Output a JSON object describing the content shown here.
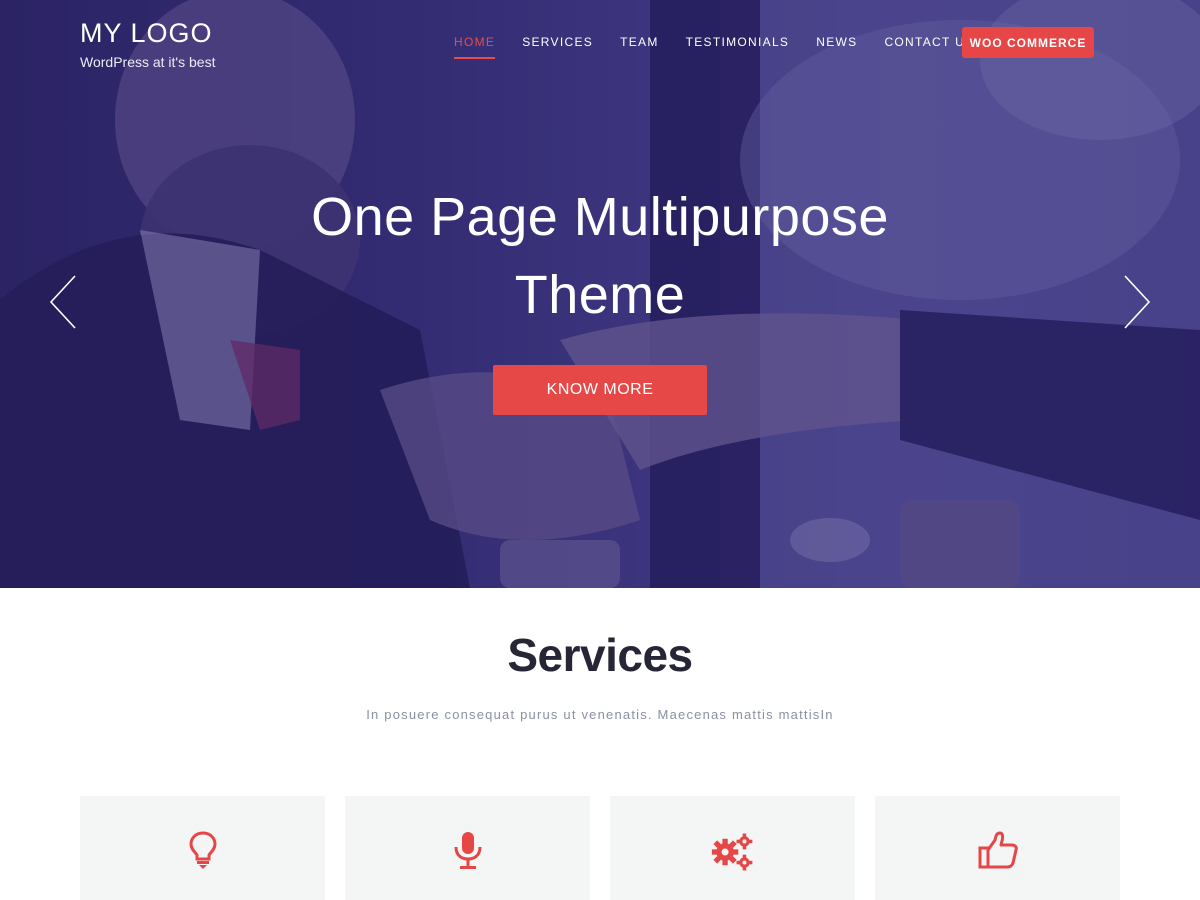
{
  "brand": {
    "title": "MY LOGO",
    "tagline": "WordPress at it's best"
  },
  "nav": {
    "items": [
      {
        "label": "HOME",
        "active": true
      },
      {
        "label": "SERVICES",
        "active": false
      },
      {
        "label": "TEAM",
        "active": false
      },
      {
        "label": "TESTIMONIALS",
        "active": false
      },
      {
        "label": "NEWS",
        "active": false
      },
      {
        "label": "CONTACT US",
        "active": false
      }
    ],
    "cta_label": "WOO COMMERCE"
  },
  "hero": {
    "title_line1": "One Page Multipurpose",
    "title_line2": "Theme",
    "button_label": "KNOW MORE",
    "prev_icon": "chevron-left-icon",
    "next_icon": "chevron-right-icon"
  },
  "services": {
    "title": "Services",
    "subtitle": "In posuere consequat purus ut venenatis. Maecenas mattis mattisIn",
    "cards": [
      {
        "icon": "lightbulb-icon"
      },
      {
        "icon": "microphone-icon"
      },
      {
        "icon": "gears-icon"
      },
      {
        "icon": "thumbs-up-icon"
      }
    ]
  },
  "colors": {
    "accent": "#e64646",
    "hero_overlay": "#2c2476",
    "heading": "#262637",
    "subtitle": "#8b90a4",
    "card_bg": "#f4f5f5"
  }
}
